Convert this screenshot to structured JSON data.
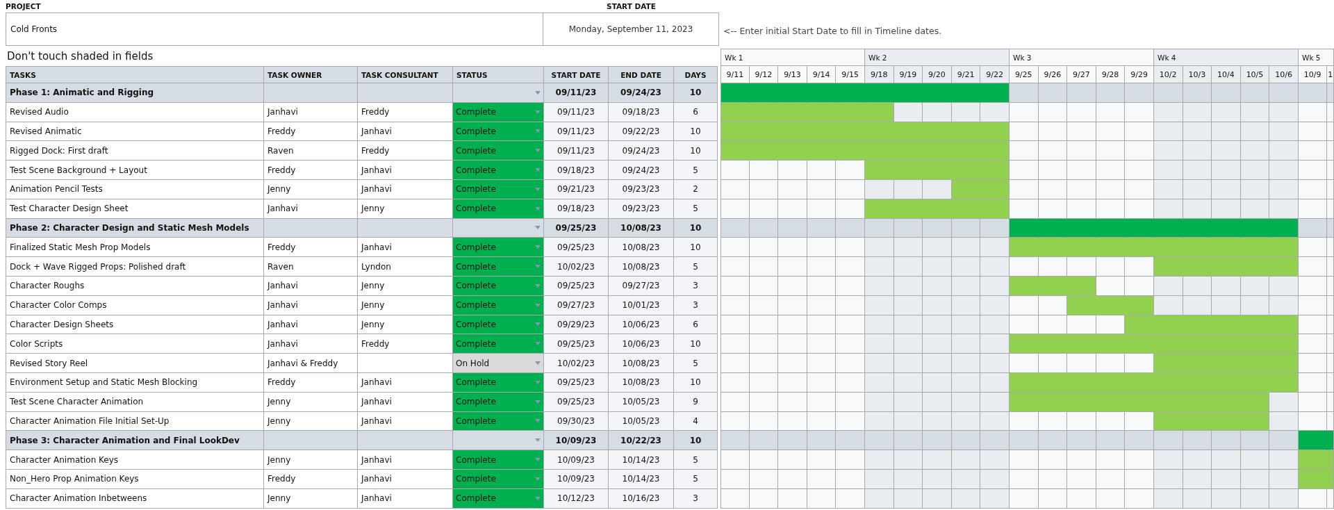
{
  "project": {
    "label": "PROJECT",
    "name": "Cold Fronts"
  },
  "start_date": {
    "label": "START DATE",
    "value": "Monday, September 11, 2023",
    "hint": "<-- Enter initial Start Date to fill in Timeline dates."
  },
  "note": "Don't touch shaded in fields",
  "columns": [
    "TASKS",
    "TASK OWNER",
    "TASK CONSULTANT",
    "STATUS",
    "START DATE",
    "END DATE",
    "DAYS"
  ],
  "weeks": [
    {
      "label": "Wk 1",
      "shaded": false,
      "days": [
        "9/11",
        "9/12",
        "9/13",
        "9/14",
        "9/15"
      ]
    },
    {
      "label": "Wk 2",
      "shaded": true,
      "days": [
        "9/18",
        "9/19",
        "9/20",
        "9/21",
        "9/22"
      ]
    },
    {
      "label": "Wk 3",
      "shaded": false,
      "days": [
        "9/25",
        "9/26",
        "9/27",
        "9/28",
        "9/29"
      ]
    },
    {
      "label": "Wk 4",
      "shaded": true,
      "days": [
        "10/2",
        "10/3",
        "10/4",
        "10/5",
        "10/6"
      ]
    },
    {
      "label": "Wk 5",
      "shaded": false,
      "days": [
        "10/9",
        "1"
      ]
    }
  ],
  "rows": [
    {
      "kind": "phase",
      "task": "Phase 1: Animatic and Rigging",
      "start": "09/11/23",
      "end": "09/24/23",
      "days": "10",
      "bar": [
        true,
        true,
        true,
        true,
        true,
        true,
        true,
        true,
        true,
        true,
        false,
        false,
        false,
        false,
        false,
        false,
        false,
        false,
        false,
        false,
        false,
        false
      ]
    },
    {
      "kind": "task",
      "task": "Revised Audio",
      "owner": "Janhavi",
      "consultant": "Freddy",
      "status": {
        "label": "Complete",
        "kind": "complete"
      },
      "start": "09/11/23",
      "end": "09/18/23",
      "days": "6",
      "bar": [
        true,
        true,
        true,
        true,
        true,
        true,
        false,
        false,
        false,
        false,
        false,
        false,
        false,
        false,
        false,
        false,
        false,
        false,
        false,
        false,
        false,
        false
      ]
    },
    {
      "kind": "task",
      "task": "Revised Animatic",
      "owner": "Freddy",
      "consultant": "Janhavi",
      "status": {
        "label": "Complete",
        "kind": "complete"
      },
      "start": "09/11/23",
      "end": "09/22/23",
      "days": "10",
      "bar": [
        true,
        true,
        true,
        true,
        true,
        true,
        true,
        true,
        true,
        true,
        false,
        false,
        false,
        false,
        false,
        false,
        false,
        false,
        false,
        false,
        false,
        false
      ]
    },
    {
      "kind": "task",
      "task": "Rigged Dock: First draft",
      "owner": "Raven",
      "consultant": "Freddy",
      "status": {
        "label": "Complete",
        "kind": "complete"
      },
      "start": "09/11/23",
      "end": "09/24/23",
      "days": "10",
      "bar": [
        true,
        true,
        true,
        true,
        true,
        true,
        true,
        true,
        true,
        true,
        false,
        false,
        false,
        false,
        false,
        false,
        false,
        false,
        false,
        false,
        false,
        false
      ]
    },
    {
      "kind": "task",
      "task": "Test Scene Background + Layout",
      "owner": "Freddy",
      "consultant": "Janhavi",
      "status": {
        "label": "Complete",
        "kind": "complete"
      },
      "start": "09/18/23",
      "end": "09/24/23",
      "days": "5",
      "bar": [
        false,
        false,
        false,
        false,
        false,
        true,
        true,
        true,
        true,
        true,
        false,
        false,
        false,
        false,
        false,
        false,
        false,
        false,
        false,
        false,
        false,
        false
      ]
    },
    {
      "kind": "task",
      "task": "Animation Pencil Tests",
      "owner": "Jenny",
      "consultant": "Janhavi",
      "status": {
        "label": "Complete",
        "kind": "complete"
      },
      "start": "09/21/23",
      "end": "09/23/23",
      "days": "2",
      "bar": [
        false,
        false,
        false,
        false,
        false,
        false,
        false,
        false,
        true,
        true,
        false,
        false,
        false,
        false,
        false,
        false,
        false,
        false,
        false,
        false,
        false,
        false
      ]
    },
    {
      "kind": "task",
      "task": "Test Character Design Sheet",
      "owner": "Janhavi",
      "consultant": "Jenny",
      "status": {
        "label": "Complete",
        "kind": "complete"
      },
      "start": "09/18/23",
      "end": "09/23/23",
      "days": "5",
      "bar": [
        false,
        false,
        false,
        false,
        false,
        true,
        true,
        true,
        true,
        true,
        false,
        false,
        false,
        false,
        false,
        false,
        false,
        false,
        false,
        false,
        false,
        false
      ]
    },
    {
      "kind": "phase",
      "task": "Phase 2: Character Design and Static Mesh Models",
      "start": "09/25/23",
      "end": "10/08/23",
      "days": "10",
      "bar": [
        false,
        false,
        false,
        false,
        false,
        false,
        false,
        false,
        false,
        false,
        true,
        true,
        true,
        true,
        true,
        true,
        true,
        true,
        true,
        true,
        false,
        false
      ]
    },
    {
      "kind": "task",
      "task": "Finalized Static Mesh Prop Models",
      "owner": "Freddy",
      "consultant": "Janhavi",
      "status": {
        "label": "Complete",
        "kind": "complete"
      },
      "start": "09/25/23",
      "end": "10/08/23",
      "days": "10",
      "bar": [
        false,
        false,
        false,
        false,
        false,
        false,
        false,
        false,
        false,
        false,
        true,
        true,
        true,
        true,
        true,
        true,
        true,
        true,
        true,
        true,
        false,
        false
      ]
    },
    {
      "kind": "task",
      "task": "Dock + Wave Rigged Props: Polished draft",
      "owner": "Raven",
      "consultant": "Lyndon",
      "status": {
        "label": "Complete",
        "kind": "complete"
      },
      "start": "10/02/23",
      "end": "10/08/23",
      "days": "5",
      "bar": [
        false,
        false,
        false,
        false,
        false,
        false,
        false,
        false,
        false,
        false,
        false,
        false,
        false,
        false,
        false,
        true,
        true,
        true,
        true,
        true,
        false,
        false
      ]
    },
    {
      "kind": "task",
      "task": "Character Roughs",
      "owner": "Janhavi",
      "consultant": "Jenny",
      "status": {
        "label": "Complete",
        "kind": "complete"
      },
      "start": "09/25/23",
      "end": "09/27/23",
      "days": "3",
      "bar": [
        false,
        false,
        false,
        false,
        false,
        false,
        false,
        false,
        false,
        false,
        true,
        true,
        true,
        false,
        false,
        false,
        false,
        false,
        false,
        false,
        false,
        false
      ]
    },
    {
      "kind": "task",
      "task": "Character Color Comps",
      "owner": "Janhavi",
      "consultant": "Jenny",
      "status": {
        "label": "Complete",
        "kind": "complete"
      },
      "start": "09/27/23",
      "end": "10/01/23",
      "days": "3",
      "bar": [
        false,
        false,
        false,
        false,
        false,
        false,
        false,
        false,
        false,
        false,
        false,
        false,
        true,
        true,
        true,
        false,
        false,
        false,
        false,
        false,
        false,
        false
      ]
    },
    {
      "kind": "task",
      "task": "Character Design Sheets",
      "owner": "Janhavi",
      "consultant": "Jenny",
      "status": {
        "label": "Complete",
        "kind": "complete"
      },
      "start": "09/29/23",
      "end": "10/06/23",
      "days": "6",
      "bar": [
        false,
        false,
        false,
        false,
        false,
        false,
        false,
        false,
        false,
        false,
        false,
        false,
        false,
        false,
        true,
        true,
        true,
        true,
        true,
        true,
        false,
        false
      ]
    },
    {
      "kind": "task",
      "task": "Color Scripts",
      "owner": "Janhavi",
      "consultant": "Freddy",
      "status": {
        "label": "Complete",
        "kind": "complete"
      },
      "start": "09/25/23",
      "end": "10/06/23",
      "days": "10",
      "bar": [
        false,
        false,
        false,
        false,
        false,
        false,
        false,
        false,
        false,
        false,
        true,
        true,
        true,
        true,
        true,
        true,
        true,
        true,
        true,
        true,
        false,
        false
      ]
    },
    {
      "kind": "task",
      "task": "Revised Story Reel",
      "owner": "Janhavi & Freddy",
      "status": {
        "label": "On Hold",
        "kind": "on_hold"
      },
      "start": "10/02/23",
      "end": "10/08/23",
      "days": "5",
      "bar": [
        false,
        false,
        false,
        false,
        false,
        false,
        false,
        false,
        false,
        false,
        false,
        false,
        false,
        false,
        false,
        true,
        true,
        true,
        true,
        true,
        false,
        false
      ]
    },
    {
      "kind": "task",
      "task": "Environment Setup and Static Mesh Blocking",
      "owner": "Freddy",
      "consultant": "Janhavi",
      "status": {
        "label": "Complete",
        "kind": "complete"
      },
      "start": "09/25/23",
      "end": "10/08/23",
      "days": "10",
      "bar": [
        false,
        false,
        false,
        false,
        false,
        false,
        false,
        false,
        false,
        false,
        true,
        true,
        true,
        true,
        true,
        true,
        true,
        true,
        true,
        true,
        false,
        false
      ]
    },
    {
      "kind": "task",
      "task": "Test Scene Character Animation",
      "owner": "Jenny",
      "consultant": "Janhavi",
      "status": {
        "label": "Complete",
        "kind": "complete"
      },
      "start": "09/25/23",
      "end": "10/05/23",
      "days": "9",
      "bar": [
        false,
        false,
        false,
        false,
        false,
        false,
        false,
        false,
        false,
        false,
        true,
        true,
        true,
        true,
        true,
        true,
        true,
        true,
        true,
        false,
        false,
        false
      ]
    },
    {
      "kind": "task",
      "task": "Character Animation File Initial Set-Up",
      "owner": "Jenny",
      "consultant": "Janhavi",
      "status": {
        "label": "Complete",
        "kind": "complete"
      },
      "start": "09/30/23",
      "end": "10/05/23",
      "days": "4",
      "bar": [
        false,
        false,
        false,
        false,
        false,
        false,
        false,
        false,
        false,
        false,
        false,
        false,
        false,
        false,
        false,
        true,
        true,
        true,
        true,
        false,
        false,
        false
      ]
    },
    {
      "kind": "phase",
      "task": "Phase 3: Character Animation and Final LookDev",
      "start": "10/09/23",
      "end": "10/22/23",
      "days": "10",
      "bar": [
        false,
        false,
        false,
        false,
        false,
        false,
        false,
        false,
        false,
        false,
        false,
        false,
        false,
        false,
        false,
        false,
        false,
        false,
        false,
        false,
        true,
        true
      ]
    },
    {
      "kind": "task",
      "task": "Character Animation Keys",
      "owner": "Jenny",
      "consultant": "Janhavi",
      "status": {
        "label": "Complete",
        "kind": "complete"
      },
      "start": "10/09/23",
      "end": "10/14/23",
      "days": "5",
      "bar": [
        false,
        false,
        false,
        false,
        false,
        false,
        false,
        false,
        false,
        false,
        false,
        false,
        false,
        false,
        false,
        false,
        false,
        false,
        false,
        false,
        true,
        true
      ]
    },
    {
      "kind": "task",
      "task": "Non_Hero Prop Animation Keys",
      "owner": "Freddy",
      "consultant": "Janhavi",
      "status": {
        "label": "Complete",
        "kind": "complete"
      },
      "start": "10/09/23",
      "end": "10/14/23",
      "days": "5",
      "bar": [
        false,
        false,
        false,
        false,
        false,
        false,
        false,
        false,
        false,
        false,
        false,
        false,
        false,
        false,
        false,
        false,
        false,
        false,
        false,
        false,
        true,
        true
      ]
    },
    {
      "kind": "task",
      "task": "Character Animation Inbetweens",
      "owner": "Jenny",
      "consultant": "Janhavi",
      "status": {
        "label": "Complete",
        "kind": "complete"
      },
      "start": "10/12/23",
      "end": "10/16/23",
      "days": "3",
      "bar": [
        false,
        false,
        false,
        false,
        false,
        false,
        false,
        false,
        false,
        false,
        false,
        false,
        false,
        false,
        false,
        false,
        false,
        false,
        false,
        false,
        false,
        false
      ]
    }
  ]
}
